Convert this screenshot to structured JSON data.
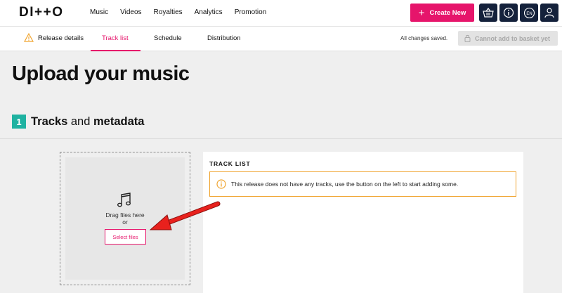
{
  "topbar": {
    "logo": "DI++O",
    "nav": [
      "Music",
      "Videos",
      "Royalties",
      "Analytics",
      "Promotion"
    ],
    "create_label": "Create New",
    "icons": [
      "basket-icon",
      "info-icon",
      "language-icon",
      "user-icon"
    ],
    "language_code": "EN"
  },
  "tabs": {
    "items": [
      {
        "label": "Release details",
        "warning": true
      },
      {
        "label": "Track list",
        "active": true
      },
      {
        "label": "Schedule"
      },
      {
        "label": "Distribution"
      }
    ],
    "status": "All changes saved.",
    "basket_label": "Cannot add to basket yet"
  },
  "page": {
    "title": "Upload your music",
    "section": {
      "number": "1",
      "title_bold_1": "Tracks",
      "title_mid": " and ",
      "title_bold_2": "metadata"
    }
  },
  "upload": {
    "drag_text": "Drag files here",
    "or_text": "or",
    "select_label": "Select files"
  },
  "tracklist": {
    "title": "TRACK LIST",
    "alert": "This release does not have any tracks, use the button on the left to start adding some."
  },
  "colors": {
    "accent": "#e6156b",
    "navy": "#14213b",
    "teal": "#1fb2a1",
    "warning": "#f0a42f",
    "annotation": "#e8211d"
  }
}
